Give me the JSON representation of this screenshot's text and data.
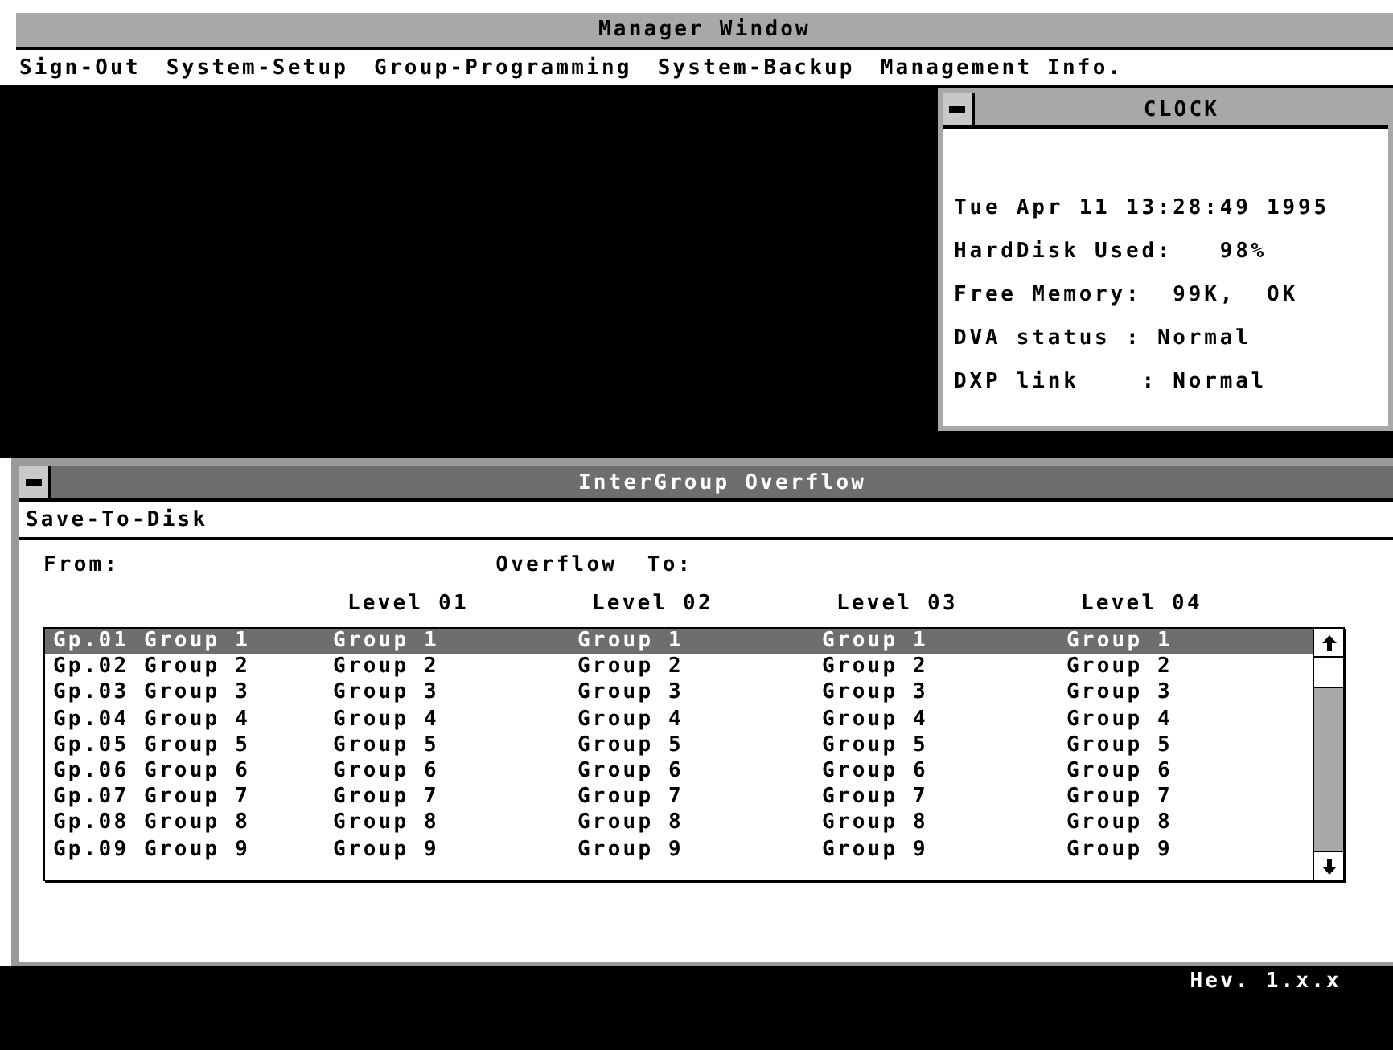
{
  "window": {
    "title": "Manager Window"
  },
  "menu": [
    "Sign-Out",
    "System-Setup",
    "Group-Programming",
    "System-Backup",
    "Management Info."
  ],
  "clock": {
    "title": "CLOCK",
    "lines": [
      "Tue Apr 11 13:28:49 1995",
      "HardDisk Used:   98%",
      "Free Memory:  99K,  OK",
      "DVA status : Normal",
      "DXP link    : Normal"
    ]
  },
  "overflow": {
    "title": "InterGroup Overflow",
    "menu": [
      "Save-To-Disk"
    ],
    "from_label": "From:",
    "to_label": "Overflow  To:",
    "columns": [
      "Level 01",
      "Level 02",
      "Level 03",
      "Level 04"
    ],
    "rows": [
      {
        "from": "Gp.01 Group 1",
        "levels": [
          "Group 1",
          "Group 1",
          "Group 1",
          "Group 1"
        ],
        "selected": true
      },
      {
        "from": "Gp.02 Group 2",
        "levels": [
          "Group 2",
          "Group 2",
          "Group 2",
          "Group 2"
        ],
        "selected": false
      },
      {
        "from": "Gp.03 Group 3",
        "levels": [
          "Group 3",
          "Group 3",
          "Group 3",
          "Group 3"
        ],
        "selected": false
      },
      {
        "from": "Gp.04 Group 4",
        "levels": [
          "Group 4",
          "Group 4",
          "Group 4",
          "Group 4"
        ],
        "selected": false
      },
      {
        "from": "Gp.05 Group 5",
        "levels": [
          "Group 5",
          "Group 5",
          "Group 5",
          "Group 5"
        ],
        "selected": false
      },
      {
        "from": "Gp.06 Group 6",
        "levels": [
          "Group 6",
          "Group 6",
          "Group 6",
          "Group 6"
        ],
        "selected": false
      },
      {
        "from": "Gp.07 Group 7",
        "levels": [
          "Group 7",
          "Group 7",
          "Group 7",
          "Group 7"
        ],
        "selected": false
      },
      {
        "from": "Gp.08 Group 8",
        "levels": [
          "Group 8",
          "Group 8",
          "Group 8",
          "Group 8"
        ],
        "selected": false
      },
      {
        "from": "Gp.09 Group 9",
        "levels": [
          "Group 9",
          "Group 9",
          "Group 9",
          "Group 9"
        ],
        "selected": false
      }
    ]
  },
  "status_bar": {
    "version": "Hev. 1.x.x"
  }
}
